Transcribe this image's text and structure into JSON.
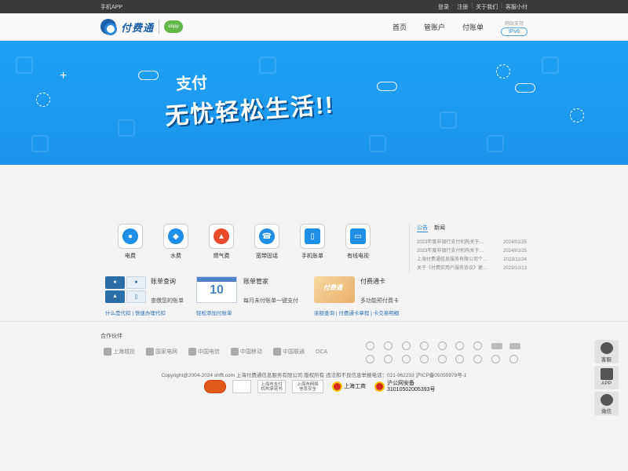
{
  "topbar": {
    "app_link": "手机APP",
    "login": "登录",
    "sep1": "-",
    "register": "注册",
    "sep2": "|",
    "about": "关于我们",
    "sep3": "|",
    "service": "客服小付"
  },
  "header": {
    "logo_text": "付费通",
    "ebpp": "ebpp",
    "nav": [
      "首页",
      "管账户",
      "付账单"
    ],
    "ipv6_label": "网站支持",
    "ipv6_badge": "IPv6"
  },
  "banner": {
    "line1": "支付",
    "line2": "无忧轻松生活!!"
  },
  "services": [
    {
      "label": "电费",
      "icon": "bulb-icon"
    },
    {
      "label": "水费",
      "icon": "water-drop-icon"
    },
    {
      "label": "燃气费",
      "icon": "flame-icon"
    },
    {
      "label": "宽带固话",
      "icon": "telephone-icon"
    },
    {
      "label": "手机账单",
      "icon": "mobile-phone-icon"
    },
    {
      "label": "有线电视",
      "icon": "tv-icon"
    }
  ],
  "news": {
    "tabs": [
      "公告",
      "新闻"
    ],
    "items": [
      {
        "title": "2023年度非银行支付机构关于…",
        "date": "2024/01/25"
      },
      {
        "title": "2023年度非银行支付机构关于…",
        "date": "2024/01/25"
      },
      {
        "title": "上海付费通信息服务有限公司个…",
        "date": "2023/11/24"
      },
      {
        "title": "关于《付费实用户服务协议》更…",
        "date": "2023/10/13"
      }
    ]
  },
  "cards": {
    "bill_query": {
      "title": "账单查询",
      "subtitle": "查缴您的账单",
      "link1": "什么是代扣",
      "link_sep": "|",
      "link2": "快速办理代扣"
    },
    "bill_manager": {
      "title": "账单管家",
      "subtitle": "每月未付账单一键支付",
      "link1": "轻松添加付账单",
      "cal_month": "JANUARY",
      "cal_day": "10"
    },
    "prepaid_card": {
      "title": "付费通卡",
      "subtitle": "多功能预付费卡",
      "link1": "余额查询",
      "link_sep1": "|",
      "link2": "付费通卡章程",
      "link_sep2": "|",
      "link3": "卡交易明细"
    }
  },
  "partners": {
    "title": "合作伙伴",
    "logos": [
      "上海城投",
      "国家电网",
      "中国电信",
      "中国移动",
      "中国联通",
      "OCA"
    ]
  },
  "footer": {
    "copyright": "Copyright@2004-2024 shfft.com 上海付费通信息服务有限公司 版权所有  违法和不良信息举报电话：021-962233  沪ICP备05055979号-1",
    "badges": [
      "上海市支付机构承诺书",
      "上海市网络信息安全"
    ],
    "gongshang": "上海工商",
    "police_title": "沪公网安备",
    "police_no": "31010502005393号"
  },
  "side": [
    {
      "label": "客服",
      "icon": "customer-service-icon"
    },
    {
      "label": "APP",
      "icon": "download-icon"
    },
    {
      "label": "微信",
      "icon": "wechat-icon"
    }
  ]
}
